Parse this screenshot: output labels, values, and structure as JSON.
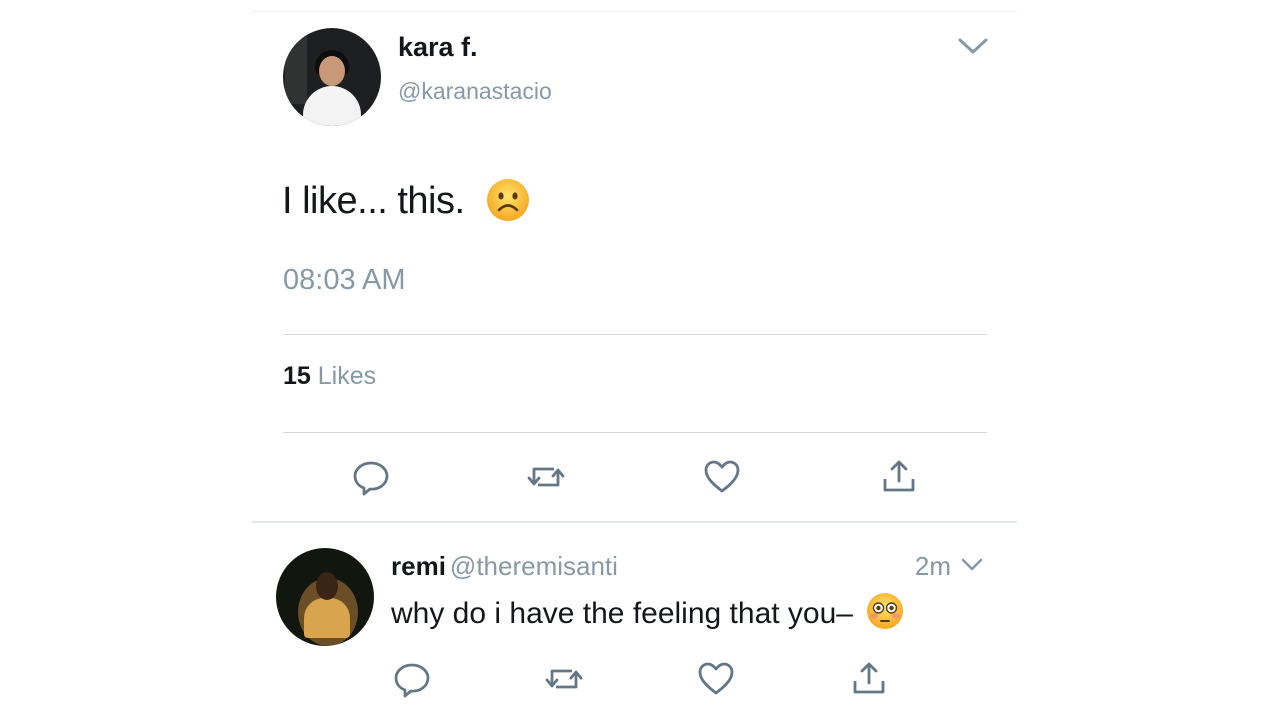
{
  "tweet": {
    "display_name": "kara f.",
    "handle": "@karanastacio",
    "text": "I like... this.",
    "text_emoji": "frowning-face-emoji",
    "timestamp": "08:03 AM",
    "likes_count": "15",
    "likes_label": "Likes"
  },
  "reply": {
    "display_name": "remi",
    "handle": "@theremisanti",
    "time": "2m",
    "text": "why do i have the feeling that you–",
    "text_emoji": "flushed-face-emoji"
  },
  "icons": {
    "reply": "reply-icon",
    "retweet": "retweet-icon",
    "like": "heart-icon",
    "share": "share-icon",
    "caret": "chevron-down-icon"
  },
  "colors": {
    "text_primary": "#14171a",
    "text_secondary": "#8899a6",
    "icon": "#657786",
    "divider": "#d5dade",
    "emoji_yellow": "#fcc21b"
  }
}
